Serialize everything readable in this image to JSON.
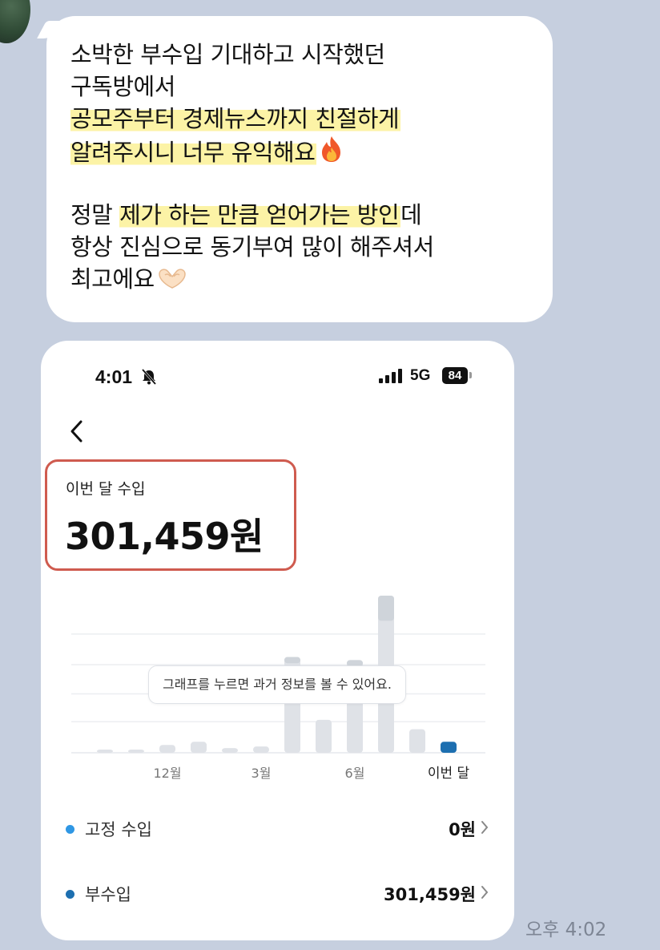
{
  "message": {
    "lines": [
      {
        "plain": "소박한 부수입 기대하고 시작했던",
        "hl": ""
      },
      {
        "plain": "구독방에서",
        "hl": ""
      },
      {
        "plain": "",
        "hl": "공모주부터 경제뉴스까지 친절하게"
      },
      {
        "plain": "",
        "hl": "알려주시니 너무 유익해요"
      },
      {
        "plain": "정말 ",
        "hl": "제가 하는 만큼 얻어가는 방인",
        "tail": "데"
      },
      {
        "plain": "항상 진심으로 동기부여 많이 해주셔서",
        "hl": ""
      },
      {
        "plain": "최고에요",
        "hl": ""
      }
    ],
    "emoji": [
      "fire-emoji",
      "heart-hands-emoji"
    ]
  },
  "phone": {
    "status_time": "4:01",
    "network": "5G",
    "battery": "84",
    "income_label": "이번 달 수입",
    "income_amount": "301,459원",
    "tooltip": "그래프를 누르면 과거 정보를 볼 수 있어요.",
    "rows": [
      {
        "label": "고정 수입",
        "value": "0원",
        "dot_color": "#2f97e4"
      },
      {
        "label": "부수입",
        "value": "301,459원",
        "dot_color": "#1d6fb0"
      }
    ]
  },
  "chart_data": {
    "type": "bar",
    "categories": [
      "",
      "",
      "12월",
      "",
      "",
      "3월",
      "",
      "",
      "6월",
      "",
      "",
      "이번 달"
    ],
    "x_tick_labels": [
      "12월",
      "3월",
      "6월",
      "이번 달"
    ],
    "values": [
      0.02,
      0.02,
      0.05,
      0.07,
      0.03,
      0.04,
      0.61,
      0.21,
      0.59,
      1.0,
      0.15,
      0.07
    ],
    "top_segment": [
      0,
      0,
      0,
      0,
      0,
      0,
      0.04,
      0,
      0.04,
      0.16,
      0,
      0
    ],
    "colors": {
      "bar": "#dfe2e7",
      "bar_top": "#cfd4da",
      "current": "#1d6fb0",
      "grid": "#eceef1"
    },
    "grid": true
  },
  "timestamp": "오후 4:02"
}
